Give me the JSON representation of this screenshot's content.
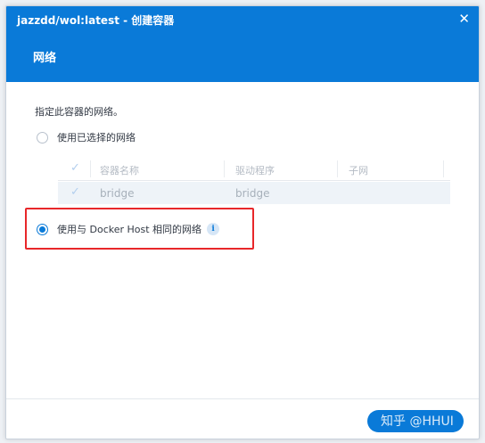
{
  "dialog": {
    "title": "jazzdd/wol:latest - 创建容器",
    "close_glyph": "✕"
  },
  "section": {
    "heading": "网络"
  },
  "network": {
    "description": "指定此容器的网络。",
    "option_selected_networks": "使用已选择的网络",
    "option_host_network": "使用与 Docker Host 相同的网络",
    "selected_option": "host",
    "info_glyph": "i",
    "table": {
      "columns": [
        "容器名称",
        "驱动程序",
        "子网"
      ],
      "rows": [
        {
          "checked": true,
          "name": "bridge",
          "driver": "bridge",
          "subnet": ""
        }
      ]
    }
  },
  "footer": {
    "next_label": ""
  },
  "watermark": "知乎 @HHUI",
  "colors": {
    "accent": "#0a7ad8",
    "highlight_border": "#e8272a"
  }
}
